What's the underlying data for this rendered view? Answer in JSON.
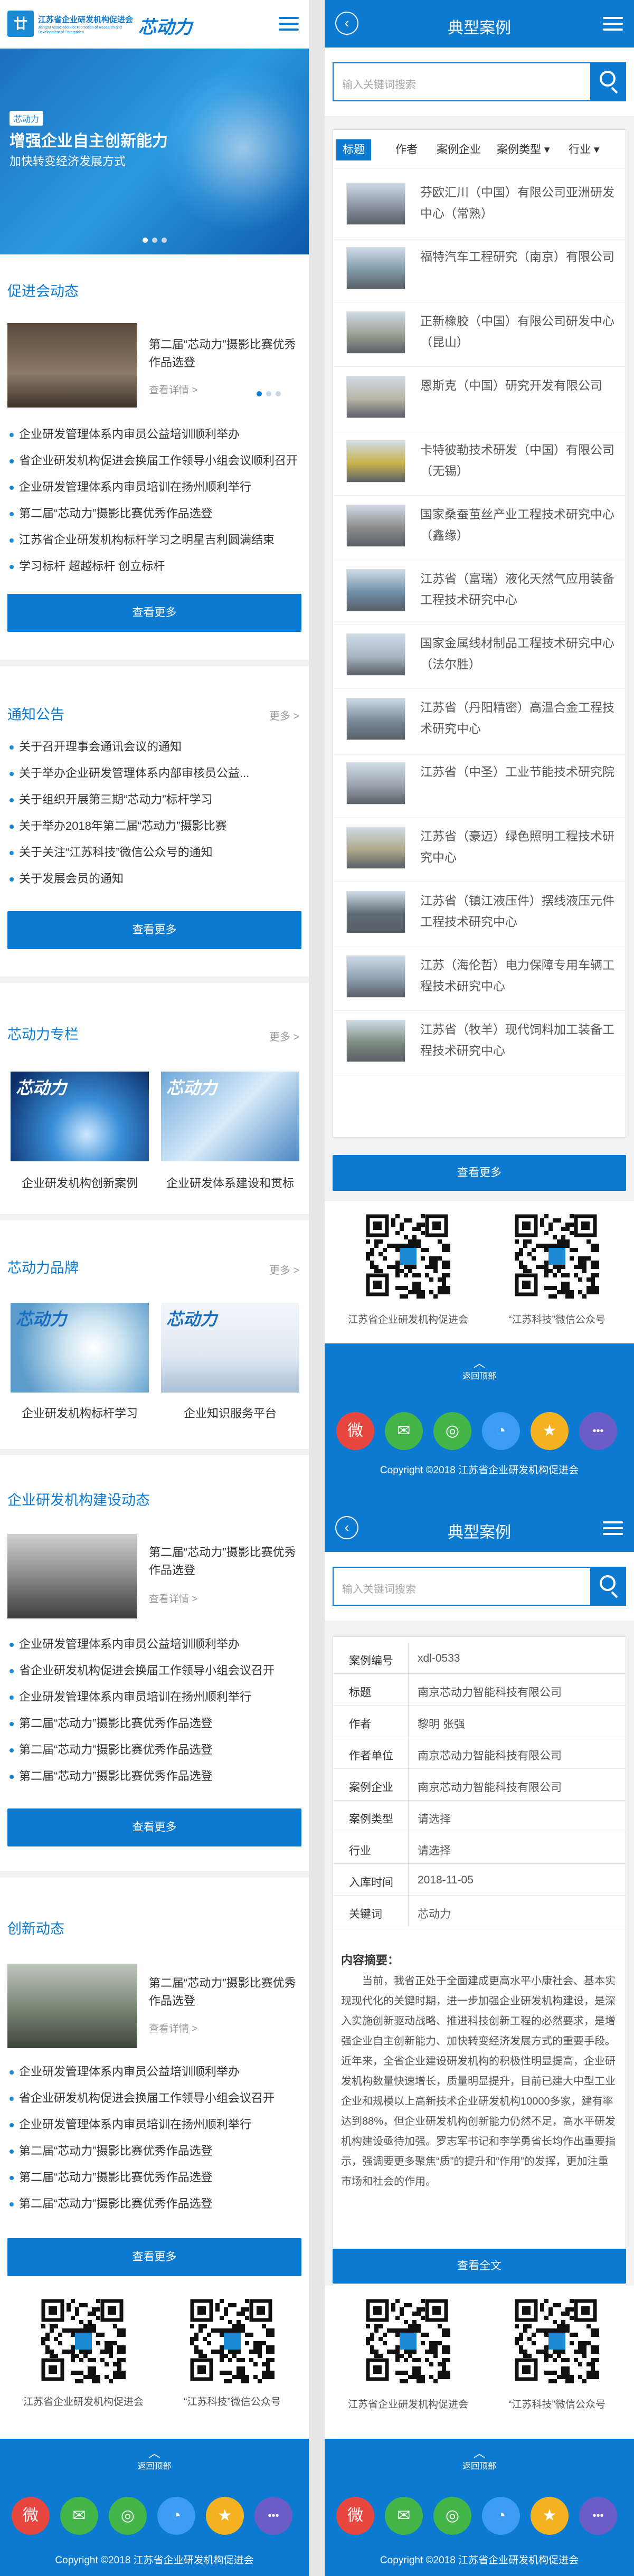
{
  "brand": {
    "org_name": "江苏省企业研发机构促进会",
    "org_name_en": "Jiangsu Association for Promotion of Research and Development of Enterprises",
    "logo_text": "芯动力"
  },
  "hero": {
    "badge": "芯动力",
    "headline": "增强企业自主创新能力",
    "sub": "加快转变经济发展方式"
  },
  "left": {
    "sections": {
      "promo": {
        "title": "促进会动态",
        "card_title": "第二届“芯动力”摄影比赛优秀作品选登",
        "card_more": "查看详情 >"
      },
      "notice": {
        "title": "通知公告",
        "more": "更多 >"
      },
      "column": {
        "title": "芯动力专栏",
        "more": "更多 >",
        "items": [
          "企业研发机构创新案例",
          "企业研发体系建设和贯标"
        ]
      },
      "brand": {
        "title": "芯动力品牌",
        "more": "更多 >",
        "items": [
          "企业研发机构标杆学习",
          "企业知识服务平台"
        ]
      },
      "build": {
        "title": "企业研发机构建设动态",
        "card_title": "第二届“芯动力”摄影比赛优秀作品选登",
        "card_more": "查看详情 >"
      },
      "innov": {
        "title": "创新动态",
        "card_title": "第二届“芯动力”摄影比赛优秀作品选登",
        "card_more": "查看详情 >"
      }
    },
    "promo_list": [
      "企业研发管理体系内审员公益培训顺利举办",
      "省企业研发机构促进会换届工作领导小组会议顺利召开",
      "企业研发管理体系内审员培训在扬州顺利举行",
      "第二届“芯动力”摄影比赛优秀作品选登",
      "江苏省企业研发机构标杆学习之明星吉利圆满结束",
      "学习标杆 超越标杆 创立标杆"
    ],
    "notice_list": [
      "关于召开理事会通讯会议的通知",
      "关于举办企业研发管理体系内部审核员公益...",
      "关于组织开展第三期“芯动力”标杆学习",
      "关于举办2018年第二届“芯动力”摄影比赛",
      "关于关注“江苏科技”微信公众号的通知",
      "关于发展会员的通知"
    ],
    "build_list": [
      "企业研发管理体系内审员公益培训顺利举办",
      "省企业研发机构促进会换届工作领导小组会议召开",
      "企业研发管理体系内审员培训在扬州顺利举行",
      "第二届“芯动力”摄影比赛优秀作品选登",
      "第二届“芯动力”摄影比赛优秀作品选登",
      "第二届“芯动力”摄影比赛优秀作品选登"
    ],
    "innov_list": [
      "企业研发管理体系内审员公益培训顺利举办",
      "省企业研发机构促进会换届工作领导小组会议召开",
      "企业研发管理体系内审员培训在扬州顺利举行",
      "第二届“芯动力”摄影比赛优秀作品选登",
      "第二届“芯动力”摄影比赛优秀作品选登",
      "第二届“芯动力”摄影比赛优秀作品选登"
    ],
    "view_more": "查看更多"
  },
  "cases": {
    "header_title": "典型案例",
    "search_placeholder": "输入关键词搜索",
    "filters": [
      "标题",
      "作者",
      "案例企业",
      "案例类型",
      "行业"
    ],
    "items": [
      "芬欧汇川（中国）有限公司亚洲研发中心（常熟）",
      "福特汽车工程研究（南京）有限公司",
      "正新橡胶（中国）有限公司研发中心（昆山）",
      "恩斯克（中国）研究开发有限公司",
      "卡特彼勒技术研发（中国）有限公司（无锡）",
      "国家桑蚕茧丝产业工程技术研究中心（鑫缘）",
      "江苏省（富瑞）液化天然气应用装备工程技术研究中心",
      "国家金属线材制品工程技术研究中心（法尔胜）",
      "江苏省（丹阳精密）高温合金工程技术研究中心",
      "江苏省（中圣）工业节能技术研究院",
      "江苏省（豪迈）绿色照明工程技术研究中心",
      "江苏省（镇江液压件）摆线液压元件工程技术研究中心",
      "江苏（海伦哲）电力保障专用车辆工程技术研究中心",
      "江苏省（牧羊）现代饲料加工装备工程技术研究中心"
    ],
    "view_more": "查看更多"
  },
  "detail": {
    "header_title": "典型案例",
    "search_placeholder": "输入关键词搜索",
    "fields": [
      {
        "k": "案例编号",
        "v": "xdl-0533"
      },
      {
        "k": "标题",
        "v": "南京芯动力智能科技有限公司"
      },
      {
        "k": "作者",
        "v": "黎明 张强"
      },
      {
        "k": "作者单位",
        "v": "南京芯动力智能科技有限公司"
      },
      {
        "k": "案例企业",
        "v": "南京芯动力智能科技有限公司"
      },
      {
        "k": "案例类型",
        "v": "请选择"
      },
      {
        "k": "行业",
        "v": "请选择"
      },
      {
        "k": "入库时间",
        "v": "2018-11-05"
      },
      {
        "k": "关键词",
        "v": "芯动力"
      }
    ],
    "summary_title": "内容摘要：",
    "summary_text": "当前，我省正处于全面建成更高水平小康社会、基本实现现代化的关键时期，进一步加强企业研发机构建设，是深入实施创新驱动战略、推进科技创新工程的必然要求，是增强企业自主创新能力、加快转变经济发展方式的重要手段。近年来，全省企业建设研发机构的积极性明显提高，企业研发机构数量快速增长，质量明显提升，目前已建大中型工业企业和规模以上高新技术企业研发机构10000多家，建有率达到88%，但企业研发机构创新能力仍然不足，高水平研发机构建设亟待加强。罗志军书记和李学勇省长均作出重要指示，强调要更多聚焦“质”的提升和“作用”的发挥，更加注重市场和社会的作用。",
    "view_all": "查看全文"
  },
  "footer": {
    "qr_left_caption": "江苏省企业研发机构促进会",
    "qr_right_caption": "“江苏科技”微信公众号",
    "back_top": "返回顶部",
    "copyright": "Copyright ©2018  江苏省企业研发机构促进会"
  },
  "colors": {
    "primary": "#0c7ad0",
    "share": [
      "#e8473f",
      "#44b549",
      "#44b549",
      "#3b9cf1",
      "#f5b220",
      "#6c5cc5"
    ]
  },
  "icons": {
    "share": [
      "weibo-icon",
      "wechat-icon",
      "moments-icon",
      "qq-icon",
      "qzone-icon",
      "more-icon"
    ]
  }
}
